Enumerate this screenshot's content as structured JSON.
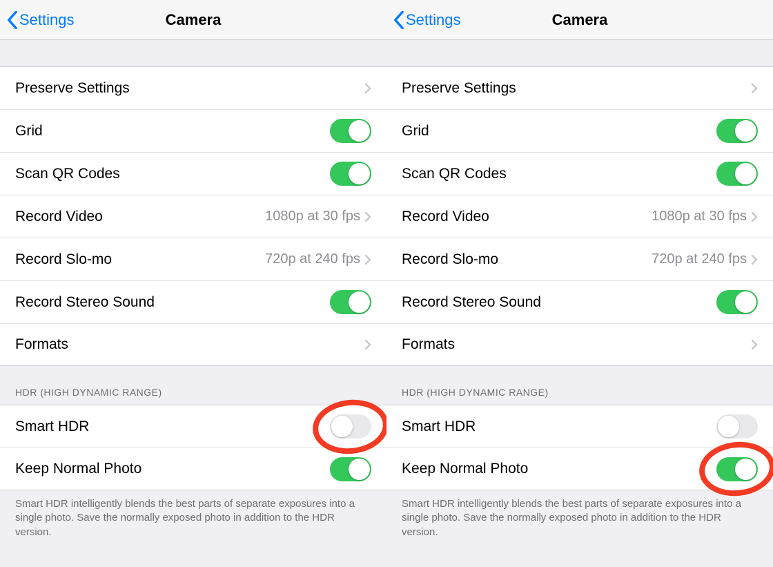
{
  "left": {
    "header": {
      "back": "Settings",
      "title": "Camera"
    },
    "rows": {
      "preserve": "Preserve Settings",
      "grid": "Grid",
      "scanqr": "Scan QR Codes",
      "recordvideo_label": "Record Video",
      "recordvideo_value": "1080p at 30 fps",
      "recordslomo_label": "Record Slo-mo",
      "recordslomo_value": "720p at 240 fps",
      "stereo": "Record Stereo Sound",
      "formats": "Formats"
    },
    "section_header": "HDR (HIGH DYNAMIC RANGE)",
    "hdr_rows": {
      "smarthdr": "Smart HDR",
      "keepnormal": "Keep Normal Photo"
    },
    "footer": "Smart HDR intelligently blends the best parts of separate exposures into a single photo. Save the normally exposed photo in addition to the HDR version.",
    "toggles": {
      "grid": true,
      "scanqr": true,
      "stereo": true,
      "smarthdr": false,
      "keepnormal": true
    },
    "annotation_target": "smarthdr"
  },
  "right": {
    "header": {
      "back": "Settings",
      "title": "Camera"
    },
    "rows": {
      "preserve": "Preserve Settings",
      "grid": "Grid",
      "scanqr": "Scan QR Codes",
      "recordvideo_label": "Record Video",
      "recordvideo_value": "1080p at 30 fps",
      "recordslomo_label": "Record Slo-mo",
      "recordslomo_value": "720p at 240 fps",
      "stereo": "Record Stereo Sound",
      "formats": "Formats"
    },
    "section_header": "HDR (HIGH DYNAMIC RANGE)",
    "hdr_rows": {
      "smarthdr": "Smart HDR",
      "keepnormal": "Keep Normal Photo"
    },
    "footer": "Smart HDR intelligently blends the best parts of separate exposures into a single photo. Save the normally exposed photo in addition to the HDR version.",
    "toggles": {
      "grid": true,
      "scanqr": true,
      "stereo": true,
      "smarthdr": false,
      "keepnormal": true
    },
    "annotation_target": "keepnormal"
  }
}
